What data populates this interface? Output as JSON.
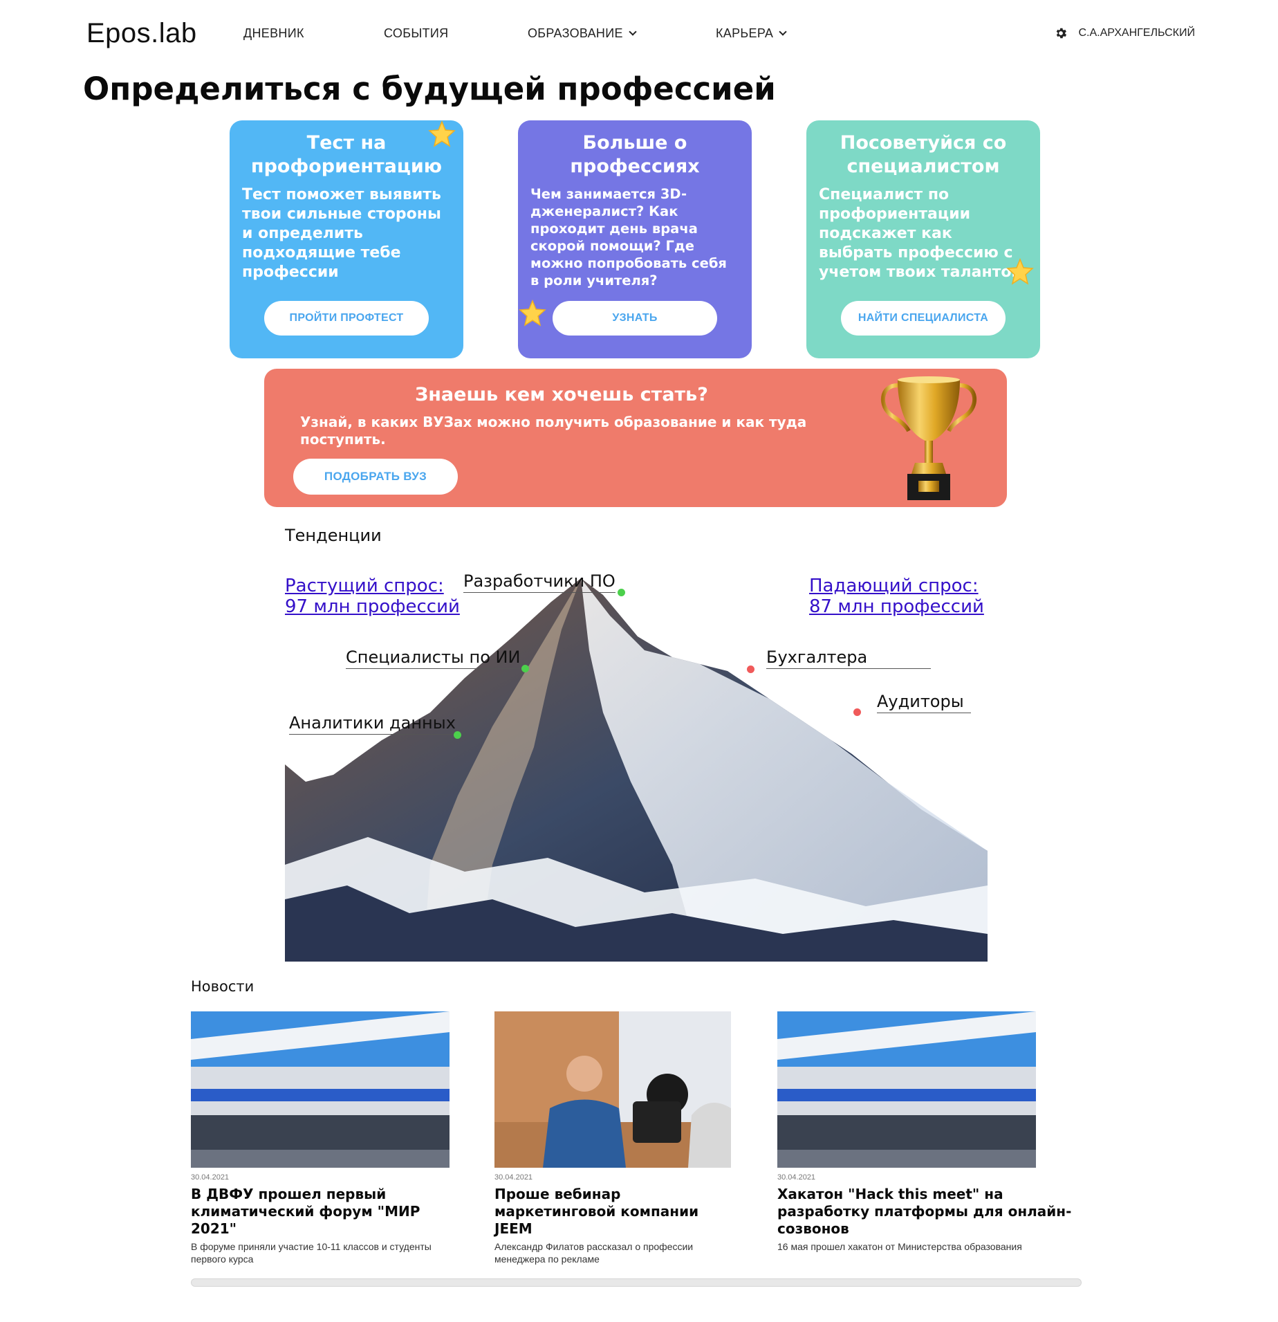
{
  "header": {
    "logo": "Epos.lab",
    "nav": [
      "ДНЕВНИК",
      "СОБЫТИЯ",
      "ОБРАЗОВАНИЕ",
      "КАРЬЕРА"
    ],
    "user_name": "С.А.АРХАНГЕЛЬСКИЙ"
  },
  "page_title": "Определиться с будущей профессией",
  "cards": [
    {
      "title": "Тест на профориентацию",
      "text": "Тест поможет выявить твои сильные стороны и определить подходящие тебе профессии",
      "button": "ПРОЙТИ ПРОФТЕСТ",
      "color": "#52b7f5"
    },
    {
      "title": "Больше о профессиях",
      "text": "Чем занимается 3D-дженералист? Как проходит день врача скорой помощи? Где можно попробовать себя в роли учителя?",
      "button": "УЗНАТЬ",
      "color": "#7576e4"
    },
    {
      "title": "Посоветуйся со специалистом",
      "text": "Специалист по профориентации подскажет как выбрать профессию с учетом твоих талантов",
      "button": "НАЙТИ СПЕЦИАЛИСТА",
      "color": "#7ed9c6"
    }
  ],
  "banner": {
    "title": "Знаешь кем хочешь стать?",
    "text": "Узнай, в каких ВУЗах можно получить образование и как туда поступить.",
    "button": "ПОДОБРАТЬ ВУЗ",
    "color": "#ef7b6b"
  },
  "trends": {
    "label": "Тенденции",
    "growing_line1": "Растущий спрос:",
    "growing_line2": "97 млн профессий",
    "falling_line1": "Падающий спрос:",
    "falling_line2": "87 млн профессий",
    "growing_professions": [
      "Разработчики ПО",
      "Специалисты по ИИ",
      "Аналитики данных"
    ],
    "falling_professions": [
      "Бухгалтера",
      "Аудиторы"
    ],
    "growing_color": "#4cd04c",
    "falling_color": "#f05a5a"
  },
  "news": {
    "label": "Новости",
    "items": [
      {
        "date": "30.04.2021",
        "title": "В ДВФУ прошел первый климатический форум \"МИР 2021\"",
        "desc": "В форуме приняли участие 10-11 классов и студенты первого курса"
      },
      {
        "date": "30.04.2021",
        "title": "Проше вебинар маркетинговой компании JEEM",
        "desc": "Александр Филатов рассказал о профессии менеджера по рекламе"
      },
      {
        "date": "30.04.2021",
        "title": "Хакатон \"Hack this meet\" на разработку платформы для онлайн-созвонов",
        "desc": "16 мая прошел хакатон от Министерства образования"
      }
    ]
  }
}
